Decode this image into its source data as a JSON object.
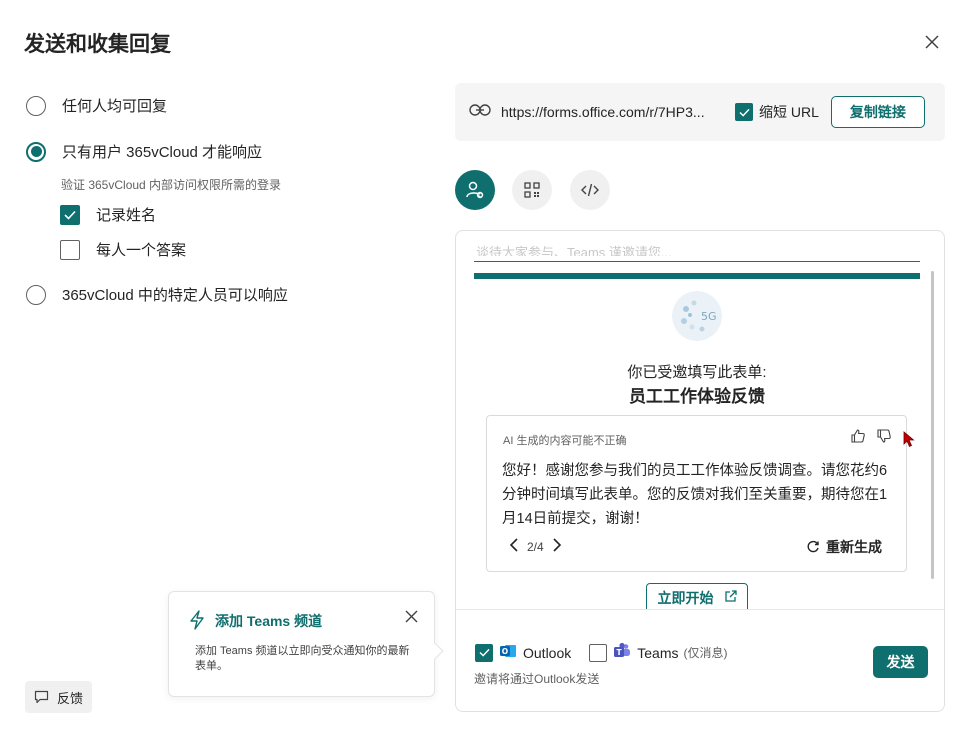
{
  "header": {
    "title": "发送和收集回复",
    "close_icon": "close-icon"
  },
  "options": {
    "anyone": "任何人均可回复",
    "org_only": "只有用户 365vCloud 才能响应",
    "org_note": "验证 365vCloud 内部访问权限所需的登录",
    "record_name": "记录姓名",
    "one_response": "每人一个答案",
    "specific": "365vCloud 中的特定人员可以响应",
    "selected": "org_only",
    "record_name_checked": true,
    "one_response_checked": false
  },
  "link": {
    "url": "https://forms.office.com/r/7HP3...",
    "shorten_label": "缩短 URL",
    "shorten_checked": true,
    "copy_label": "复制链接"
  },
  "share_modes": [
    "invite-people-icon",
    "qr-code-icon",
    "embed-code-icon"
  ],
  "preview": {
    "faded_text": "谈待大家参与、Teams 谨邀请您...",
    "invite_line": "你已受邀填写此表单:",
    "form_title": "员工工作体验反馈",
    "ai_note": "AI 生成的内容可能不正确",
    "ai_message": "您好！感谢您参与我们的员工工作体验反馈调查。请您花约6分钟时间填写此表单。您的反馈对我们至关重要，期待您在1月14日前提交，谢谢！",
    "page_indicator": "2/4",
    "regenerate": "重新生成",
    "start": "立即开始"
  },
  "send": {
    "outlook": "Outlook",
    "outlook_checked": true,
    "teams": "Teams",
    "teams_sub": "(仅消息)",
    "teams_checked": false,
    "note": "邀请将通过Outlook发送",
    "send_label": "发送"
  },
  "callout": {
    "title": "添加 Teams 频道",
    "body": "添加 Teams 频道以立即向受众通知你的最新表单。"
  },
  "feedback": {
    "label": "反馈"
  },
  "colors": {
    "accent": "#0f6e6e"
  }
}
